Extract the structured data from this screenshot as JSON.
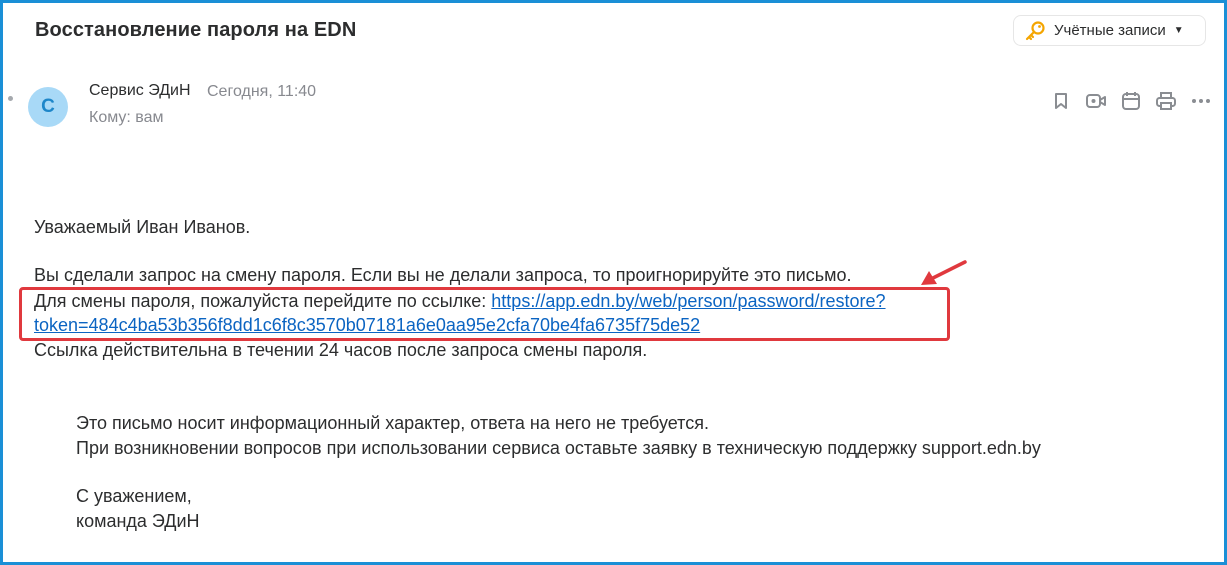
{
  "subject": "Восстановление пароля на EDN",
  "accounts_button": {
    "label": "Учётные записи",
    "icon": "key-icon"
  },
  "message": {
    "avatar_letter": "С",
    "sender": "Сервис ЭДиН",
    "date": "Сегодня, 11:40",
    "to": "Кому: вам"
  },
  "actions": [
    {
      "name": "bookmark-icon"
    },
    {
      "name": "video-call-icon"
    },
    {
      "name": "calendar-icon"
    },
    {
      "name": "print-icon"
    },
    {
      "name": "more-icon"
    }
  ],
  "body": {
    "greeting": "Уважаемый Иван Иванов.",
    "line1": "Вы сделали запрос на смену пароля. Если вы не делали запроса, то проигнорируйте это письмо.",
    "line2_prefix": "Для смены пароля, пожалуйста перейдите по ссылке: ",
    "link_part1": "https://app.edn.by/web/person/password/restore?",
    "link_part2": "token=484c4ba53b356f8dd1c6f8c3570b07181a6e0aa95e2cfa70be4fa6735f75de52",
    "line3": "Ссылка действительна в течении 24 часов после запроса смены пароля.",
    "info1": "Это письмо носит информационный характер, ответа на него не требуется.",
    "info2": "При возникновении вопросов при использовании сервиса оставьте заявку в техническую поддержку support.edn.by",
    "regards": "С уважением,",
    "team": "команда ЭДиН"
  },
  "colors": {
    "frame": "#1a8fd6",
    "link": "#0b64c2",
    "annotation": "#e0393e",
    "avatar_bg": "#a8d9f7"
  }
}
